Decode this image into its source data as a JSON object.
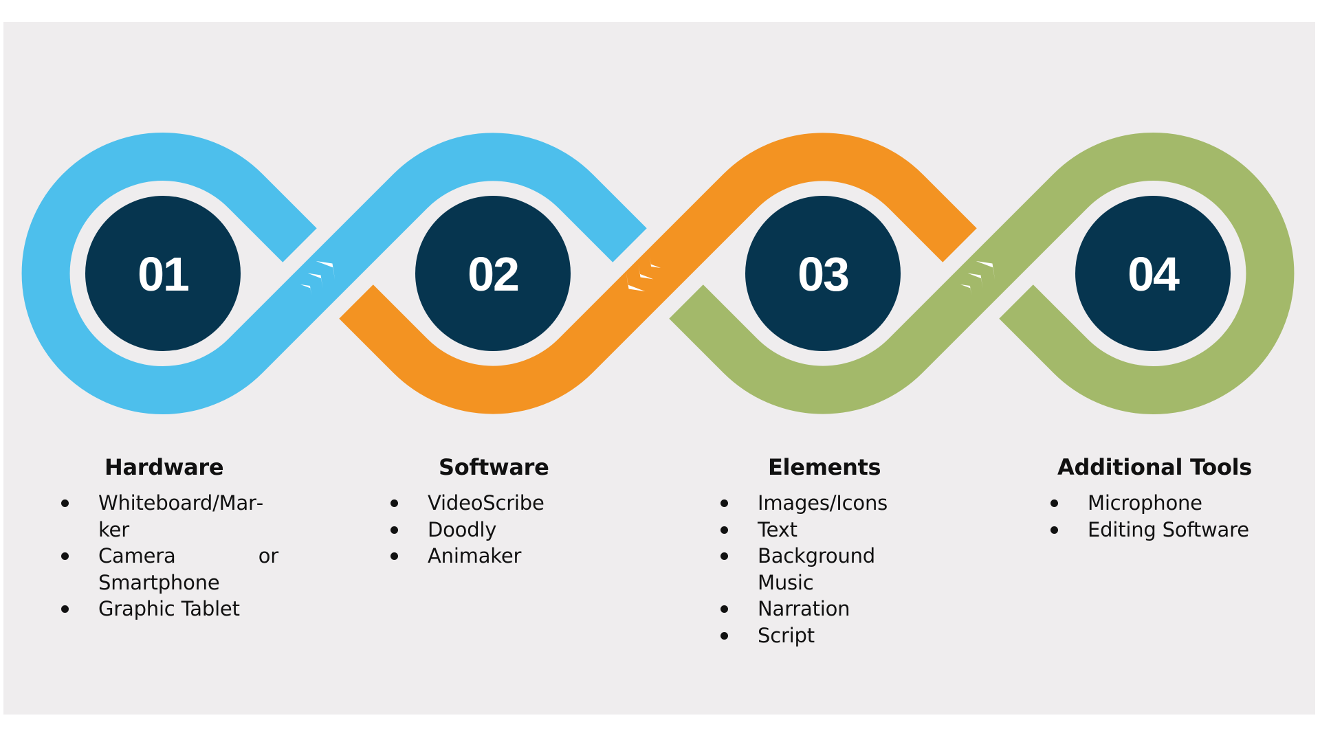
{
  "colors": {
    "background": "#EFEDEE",
    "circle": "#06354F",
    "number_text": "#FFFFFF",
    "segment_1": "#4DBFEC",
    "segment_2": "#F39322",
    "segment_3": "#A3B96A",
    "arrow": "#FFFFFF",
    "text": "#111111"
  },
  "steps": [
    {
      "number": "01",
      "title": "Hardware",
      "items": [
        "Whiteboard/Marker",
        "Camera or Smartphone",
        "Graphic Tablet"
      ]
    },
    {
      "number": "02",
      "title": "Software",
      "items": [
        "VideoScribe",
        "Doodly",
        "Animaker"
      ]
    },
    {
      "number": "03",
      "title": "Elements",
      "items": [
        "Images/Icons",
        "Text",
        "Background Music",
        "Narration",
        "Script"
      ]
    },
    {
      "number": "04",
      "title": "Additional Tools",
      "items": [
        "Microphone",
        "Editing Software"
      ]
    }
  ],
  "display_text": {
    "col1_item1": "Whiteboard/Mar­ker",
    "col1_item2": "Camera or Smartphone"
  },
  "arrows": [
    {
      "between": [
        "01",
        "02"
      ],
      "direction": "forward",
      "icon": "chevrons-up-right"
    },
    {
      "between": [
        "02",
        "03"
      ],
      "direction": "backward",
      "icon": "chevrons-down-left"
    },
    {
      "between": [
        "03",
        "04"
      ],
      "direction": "forward",
      "icon": "chevrons-up-right"
    }
  ]
}
